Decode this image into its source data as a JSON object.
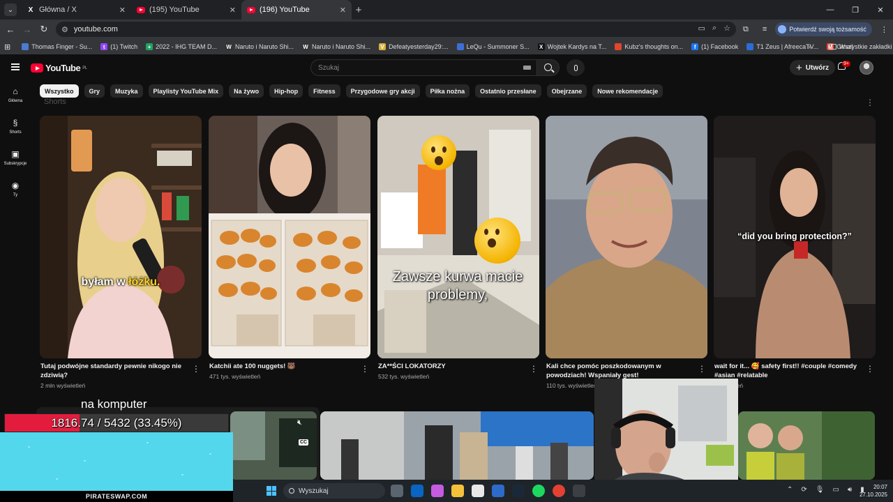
{
  "browser": {
    "tabs": [
      {
        "title": "Główna / X",
        "icon": "x-icon",
        "active": false
      },
      {
        "title": "(195) YouTube",
        "icon": "youtube-icon",
        "active": false
      },
      {
        "title": "(196) YouTube",
        "icon": "youtube-icon",
        "active": true
      }
    ],
    "url": "youtube.com",
    "verify_identity": "Potwierdź swoją tożsamość",
    "bookmarks": [
      {
        "label": "Thomas Finger - Su...",
        "color": "#4a7bd0",
        "glyph": ""
      },
      {
        "label": "(1) Twitch",
        "color": "#9146ff",
        "glyph": "t"
      },
      {
        "label": "2022 - IHG TEAM D...",
        "color": "#1fa463",
        "glyph": "+"
      },
      {
        "label": "Naruto i Naruto Shi...",
        "color": "#333333",
        "glyph": "W"
      },
      {
        "label": "Naruto i Naruto Shi...",
        "color": "#333333",
        "glyph": "W"
      },
      {
        "label": "Defeatyesterday29:...",
        "color": "#d8b13a",
        "glyph": "V"
      },
      {
        "label": "LeQu - Summoner S...",
        "color": "#3b6fd6",
        "glyph": ""
      },
      {
        "label": "Wojtek Kardys na T...",
        "color": "#111111",
        "glyph": "X"
      },
      {
        "label": "Kubz's thoughts on...",
        "color": "#e0452e",
        "glyph": ""
      },
      {
        "label": "(1) Facebook",
        "color": "#1877f2",
        "glyph": "f"
      },
      {
        "label": "T1 Zeus | AfreecaTV...",
        "color": "#2a6dd8",
        "glyph": ""
      },
      {
        "label": "Gmail",
        "color": "#ea4335",
        "glyph": "M"
      }
    ],
    "all_bookmarks": "Wszystkie zakładki"
  },
  "youtube": {
    "logo_text": "YouTube",
    "logo_region": "PL",
    "search_placeholder": "Szukaj",
    "create_label": "Utwórz",
    "notifications_badge": "9+",
    "sidebar": [
      {
        "label": "Główna",
        "icon": "home-icon",
        "glyph": "⌂"
      },
      {
        "label": "Shorts",
        "icon": "shorts-icon",
        "glyph": "§"
      },
      {
        "label": "Subskrypcje",
        "icon": "subscriptions-icon",
        "glyph": "▣"
      },
      {
        "label": "Ty",
        "icon": "user-icon",
        "glyph": "◉"
      }
    ],
    "chips": [
      "Wszystko",
      "Gry",
      "Muzyka",
      "Playlisty YouTube Mix",
      "Na żywo",
      "Hip-hop",
      "Fitness",
      "Przygodowe gry akcji",
      "Piłka nożna",
      "Ostatnio przesłane",
      "Obejrzane",
      "Nowe rekomendacje"
    ],
    "shorts_heading": "Shorts",
    "shorts": [
      {
        "title": "Tutaj podwójne standardy pewnie nikogo nie zdziwią?",
        "views": "2 mln wyświetleń",
        "overlay_pre": "byłam w ",
        "overlay_hl": "łóżku."
      },
      {
        "title": "Katchii ate 100 nuggets! 🐻",
        "views": "471 tys. wyświetleń"
      },
      {
        "title": "ZA**ŚCI LOKATORZY",
        "views": "532 tys. wyświetleń",
        "overlay": "Zawsze kurwa macie problemy,"
      },
      {
        "title": "Kali chce pomóc poszkodowanym w powodziach! Wspaniały gest!",
        "views": "110 tys. wyświetleń"
      },
      {
        "title": "wait for it... 🥰 safety first!! #couple #comedy #asian #relatable",
        "views": "wyświetleń",
        "overlay": "“did you bring protection?”"
      }
    ]
  },
  "stream_overlay": {
    "caption": "na komputer",
    "progress_text": "1816.74 / 5432 (33.45%)",
    "progress_fraction": 0.3345,
    "sponsor": "PIRATESWAP.COM",
    "cc_label": "CC"
  },
  "taskbar": {
    "search_placeholder": "Wyszukaj",
    "apps": [
      {
        "name": "task-view-icon",
        "color": "#5a6570"
      },
      {
        "name": "outlook-icon",
        "color": "#0a64c2"
      },
      {
        "name": "copilot-icon",
        "color": "#c45be0"
      },
      {
        "name": "file-explorer-icon",
        "color": "#f3c13a"
      },
      {
        "name": "store-icon",
        "color": "#e8e8e8"
      },
      {
        "name": "security-icon",
        "color": "#2e6ac9"
      },
      {
        "name": "steam-icon",
        "color": "#1b2838"
      },
      {
        "name": "spotify-icon",
        "color": "#1ed760"
      },
      {
        "name": "chrome-icon",
        "color": "#e34133"
      },
      {
        "name": "obs-icon",
        "color": "#3c3f44"
      }
    ],
    "time": "20:07",
    "date": "27.10.2025"
  }
}
